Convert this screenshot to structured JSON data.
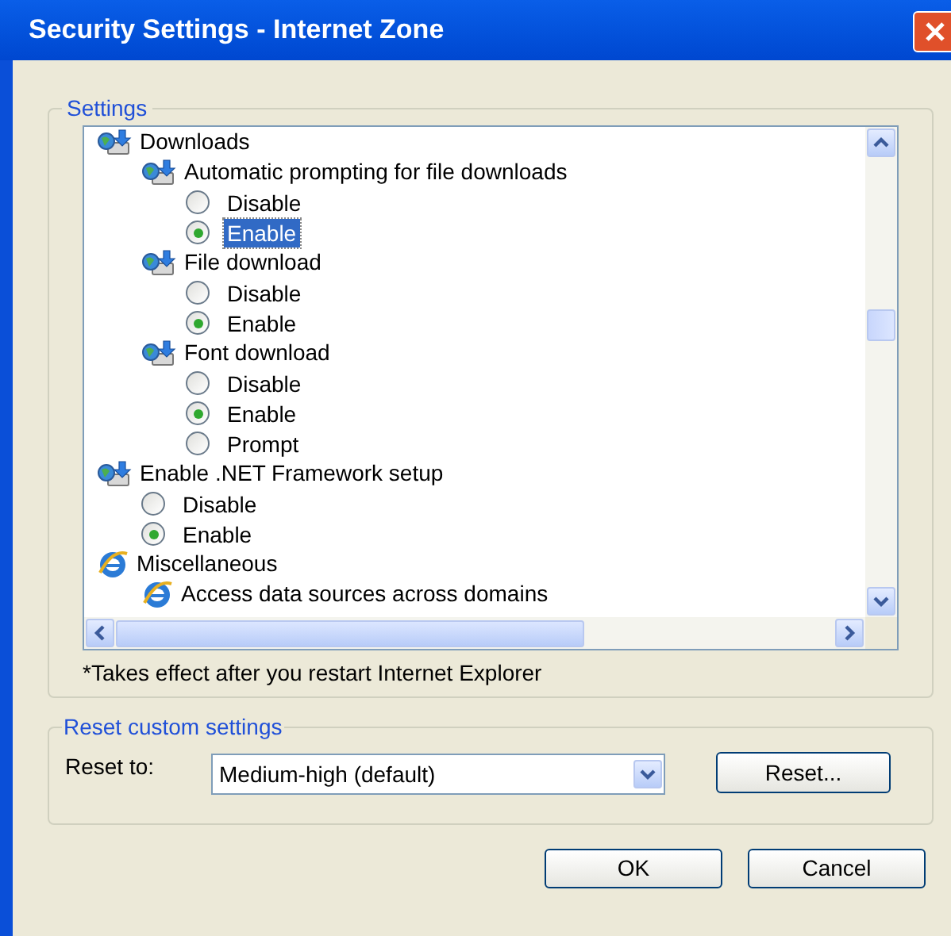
{
  "window": {
    "title": "Security Settings - Internet Zone"
  },
  "settings": {
    "legend": "Settings",
    "tree": [
      {
        "kind": "download",
        "label": "Downloads",
        "children": [
          {
            "kind": "download",
            "label": "Automatic prompting for file downloads",
            "children": [
              {
                "kind": "radio",
                "label": "Disable",
                "selected": false,
                "highlighted": false
              },
              {
                "kind": "radio",
                "label": "Enable",
                "selected": true,
                "highlighted": true
              }
            ]
          },
          {
            "kind": "download",
            "label": "File download",
            "children": [
              {
                "kind": "radio",
                "label": "Disable",
                "selected": false,
                "highlighted": false
              },
              {
                "kind": "radio",
                "label": "Enable",
                "selected": true,
                "highlighted": false
              }
            ]
          },
          {
            "kind": "download",
            "label": "Font download",
            "children": [
              {
                "kind": "radio",
                "label": "Disable",
                "selected": false,
                "highlighted": false
              },
              {
                "kind": "radio",
                "label": "Enable",
                "selected": true,
                "highlighted": false
              },
              {
                "kind": "radio",
                "label": "Prompt",
                "selected": false,
                "highlighted": false
              }
            ]
          }
        ]
      },
      {
        "kind": "download",
        "label": "Enable .NET Framework setup",
        "children": [
          {
            "kind": "radio",
            "label": "Disable",
            "selected": false,
            "highlighted": false
          },
          {
            "kind": "radio",
            "label": "Enable",
            "selected": true,
            "highlighted": false
          }
        ]
      },
      {
        "kind": "browser",
        "label": "Miscellaneous",
        "children": [
          {
            "kind": "browser",
            "label": "Access data sources across domains"
          }
        ]
      }
    ],
    "note": "*Takes effect after you restart Internet Explorer"
  },
  "reset": {
    "legend": "Reset custom settings",
    "label": "Reset to:",
    "value": "Medium-high (default)",
    "button": "Reset..."
  },
  "buttons": [
    "OK",
    "Cancel"
  ]
}
